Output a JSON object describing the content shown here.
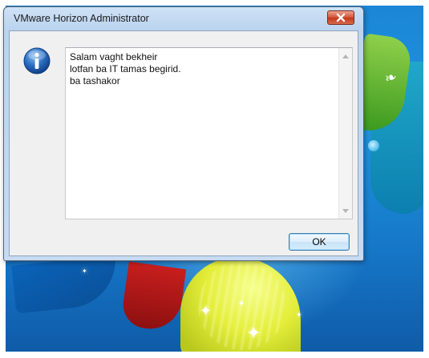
{
  "window": {
    "title": "VMware Horizon Administrator",
    "close_icon": "close-icon"
  },
  "dialog": {
    "icon": "info-icon",
    "message": "Salam vaght bekheir\nlotfan ba IT tamas begirid.\nba tashakor",
    "ok_label": "OK"
  },
  "colors": {
    "close_button": "#c2381c",
    "info_icon": "#1f5fb0",
    "desktop_blue": "#1b86d6"
  }
}
